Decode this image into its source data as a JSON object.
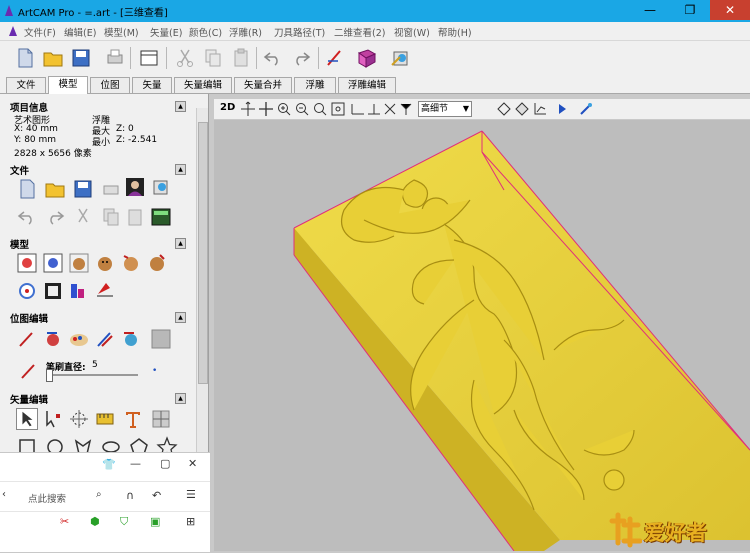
{
  "window": {
    "title": "ArtCAM Pro - =.art - [三维查看]"
  },
  "menu": [
    "文件(F)",
    "编辑(E)",
    "模型(M)",
    "矢量(E)",
    "颜色(C)",
    "浮雕(R)",
    "刀具路径(T)",
    "二维查看(2)",
    "视窗(W)",
    "帮助(H)"
  ],
  "tabs": [
    "文件",
    "模型",
    "位图",
    "矢量",
    "矢量编辑",
    "矢量合并",
    "浮雕",
    "浮雕编辑"
  ],
  "active_tab": "模型",
  "panel": {
    "project_info": {
      "heading": "项目信息",
      "type_label": "艺术图形",
      "type_value": "浮雕",
      "x_size": "X: 40 mm",
      "y_size": "Y: 80 mm",
      "max_label": "最大",
      "max_z": "Z: 0",
      "min_label": "最小",
      "min_z": "Z: -2.541",
      "pixels": "2828 x 5656 像素"
    },
    "file_section": {
      "heading": "文件"
    },
    "model_section": {
      "heading": "模型"
    },
    "bitmap_section": {
      "heading": "位图编辑",
      "brush_label": "笔刷直径:",
      "brush_value": "5"
    },
    "vector_section": {
      "heading": "矢量编辑"
    }
  },
  "view_toolbar": {
    "mode": "2D",
    "quality": "高细节"
  },
  "popup": {
    "search_placeholder": "点此搜索"
  },
  "watermark": {
    "text": "爱好者"
  },
  "colors": {
    "titlebar": "#1aa7e5",
    "relief": "#e8d23a",
    "bbox": "#e0307a",
    "viewport_bg": "#bdbdbd"
  }
}
